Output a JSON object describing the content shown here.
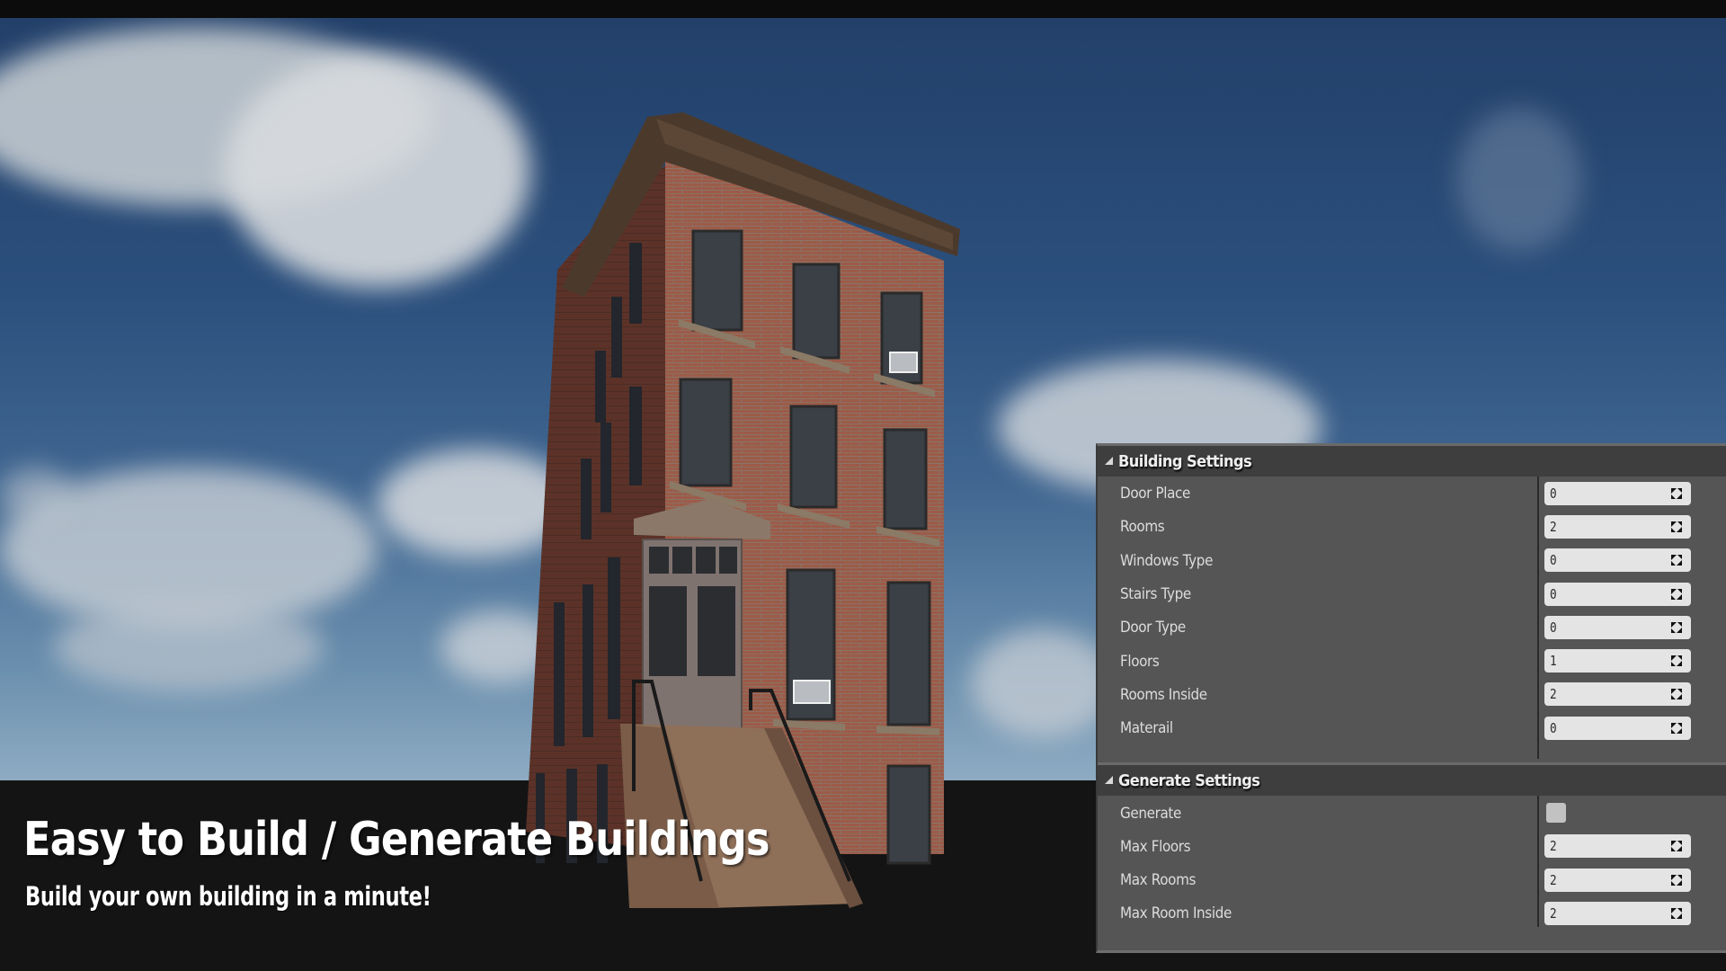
{
  "overlay": {
    "headline": "Easy to Build / Generate Buildings",
    "subline": "Build your own building in a minute!"
  },
  "panel": {
    "sections": [
      {
        "title": "Building Settings",
        "expanded": true,
        "rows": [
          {
            "label": "Door Place",
            "type": "number",
            "value": "0"
          },
          {
            "label": "Rooms",
            "type": "number",
            "value": "2"
          },
          {
            "label": "Windows Type",
            "type": "number",
            "value": "0"
          },
          {
            "label": "Stairs Type",
            "type": "number",
            "value": "0"
          },
          {
            "label": "Door Type",
            "type": "number",
            "value": "0"
          },
          {
            "label": "Floors",
            "type": "number",
            "value": "1"
          },
          {
            "label": "Rooms Inside",
            "type": "number",
            "value": "2"
          },
          {
            "label": "Materail",
            "type": "number",
            "value": "0"
          }
        ]
      },
      {
        "title": "Generate Settings",
        "expanded": true,
        "rows": [
          {
            "label": "Generate",
            "type": "checkbox",
            "value": false
          },
          {
            "label": "Max Floors",
            "type": "number",
            "value": "2"
          },
          {
            "label": "Max Rooms",
            "type": "number",
            "value": "2"
          },
          {
            "label": "Max Room Inside",
            "type": "number",
            "value": "2"
          }
        ]
      }
    ]
  },
  "icons": {
    "expand": "triangle-expanded-icon",
    "spinner": "drag-spinner-icon"
  },
  "colors": {
    "panel_bg": "#555555",
    "header_bg": "#3e3e3e",
    "input_bg": "#e4e4e4",
    "sky_top": "#22406a",
    "ground": "#141414",
    "brick": "#9a5a48"
  }
}
